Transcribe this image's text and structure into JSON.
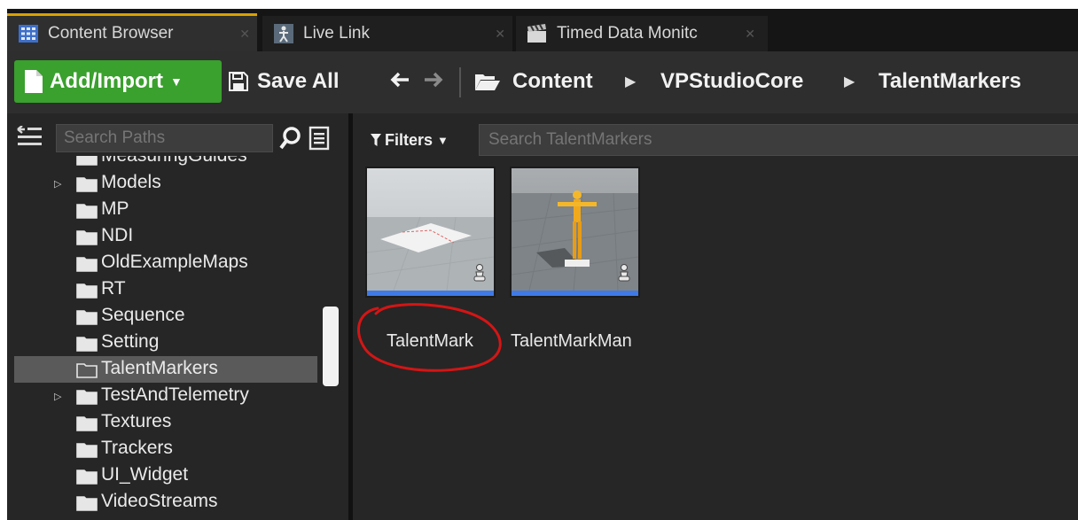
{
  "tabs": [
    {
      "label": "Content Browser",
      "icon": "content-browser-icon",
      "active": true
    },
    {
      "label": "Live Link",
      "icon": "live-link-icon",
      "active": false
    },
    {
      "label": "Timed Data Monitc",
      "icon": "clapperboard-icon",
      "active": false
    }
  ],
  "toolbar": {
    "add_import_label": "Add/Import",
    "save_all_label": "Save All",
    "breadcrumbs": [
      "Content",
      "VPStudioCore",
      "TalentMarkers"
    ]
  },
  "sources": {
    "search_placeholder": "Search Paths",
    "folders": [
      {
        "label": "MeasuringGuides",
        "expandable": false,
        "selected": false
      },
      {
        "label": "Models",
        "expandable": true,
        "selected": false
      },
      {
        "label": "MP",
        "expandable": false,
        "selected": false
      },
      {
        "label": "NDI",
        "expandable": false,
        "selected": false
      },
      {
        "label": "OldExampleMaps",
        "expandable": false,
        "selected": false
      },
      {
        "label": "RT",
        "expandable": false,
        "selected": false
      },
      {
        "label": "Sequence",
        "expandable": false,
        "selected": false
      },
      {
        "label": "Setting",
        "expandable": false,
        "selected": false
      },
      {
        "label": "TalentMarkers",
        "expandable": false,
        "selected": true
      },
      {
        "label": "TestAndTelemetry",
        "expandable": true,
        "selected": false
      },
      {
        "label": "Textures",
        "expandable": false,
        "selected": false
      },
      {
        "label": "Trackers",
        "expandable": false,
        "selected": false
      },
      {
        "label": "UI_Widget",
        "expandable": false,
        "selected": false
      },
      {
        "label": "VideoStreams",
        "expandable": false,
        "selected": false
      }
    ]
  },
  "assets": {
    "filters_label": "Filters",
    "search_placeholder": "Search TalentMarkers",
    "items": [
      {
        "name": "TalentMark"
      },
      {
        "name": "TalentMarkMan"
      }
    ]
  },
  "colors": {
    "add_button": "#3aa02e",
    "active_tab_accent": "#d9a200",
    "asset_bar": "#3f7ae8",
    "annotation": "#d41515"
  }
}
